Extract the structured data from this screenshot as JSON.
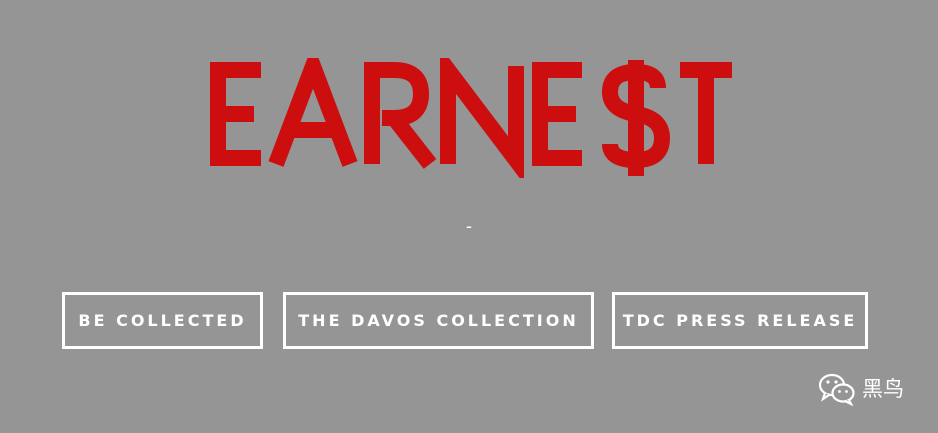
{
  "brand": {
    "logo_text": "EARNE$T",
    "logo_color": "#cc0e0e"
  },
  "page": {
    "background_color": "#959595",
    "separator": "-"
  },
  "nav": {
    "buttons": [
      {
        "label": "BE COLLECTED"
      },
      {
        "label": "THE DAVOS COLLECTION"
      },
      {
        "label": "TDC PRESS RELEASE"
      }
    ]
  },
  "watermark": {
    "icon": "wechat-icon",
    "text": "黑鸟"
  }
}
